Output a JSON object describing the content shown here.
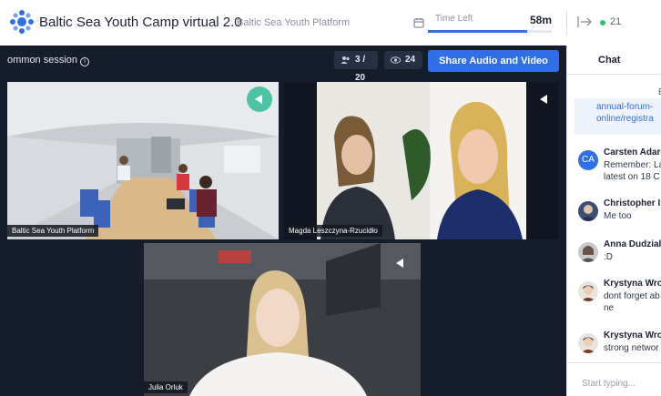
{
  "header": {
    "app_title": "Baltic Sea Youth Camp virtual 2.0",
    "subtitle": "Baltic Sea Youth Platform",
    "time_left_label": "Time Left",
    "time_left_value": "58m",
    "time_left_progress": 0.8,
    "online_count": "21",
    "accent_color": "#2f6fe8",
    "online_color": "#2fbf71"
  },
  "stage": {
    "session_title": "ommon session",
    "participants": "3 / 20",
    "viewers": "24",
    "share_button": "Share Audio and Video",
    "tiles": [
      {
        "label": "Baltic Sea Youth Platform"
      },
      {
        "label": "Magda Leszczyna-Rzucidło"
      },
      {
        "label": "Julia Orluk"
      }
    ]
  },
  "chat": {
    "title": "Chat",
    "truncated_header": "E",
    "link_lines": [
      "annual-forum-",
      "online/registra"
    ],
    "messages": [
      {
        "initials": "CA",
        "name": "Carsten Adar",
        "lines": [
          "Remember: La",
          "latest on 18 C"
        ]
      },
      {
        "name": "Christopher I",
        "lines": [
          "Me too"
        ]
      },
      {
        "name": "Anna Dudzial",
        "lines": [
          ":D"
        ]
      },
      {
        "name": "Krystyna Wro",
        "lines": [
          "dont forget ab",
          "ne"
        ]
      },
      {
        "name": "Krystyna Wro",
        "lines": [
          "strong networ"
        ]
      }
    ],
    "input_placeholder": "Start typing..."
  }
}
